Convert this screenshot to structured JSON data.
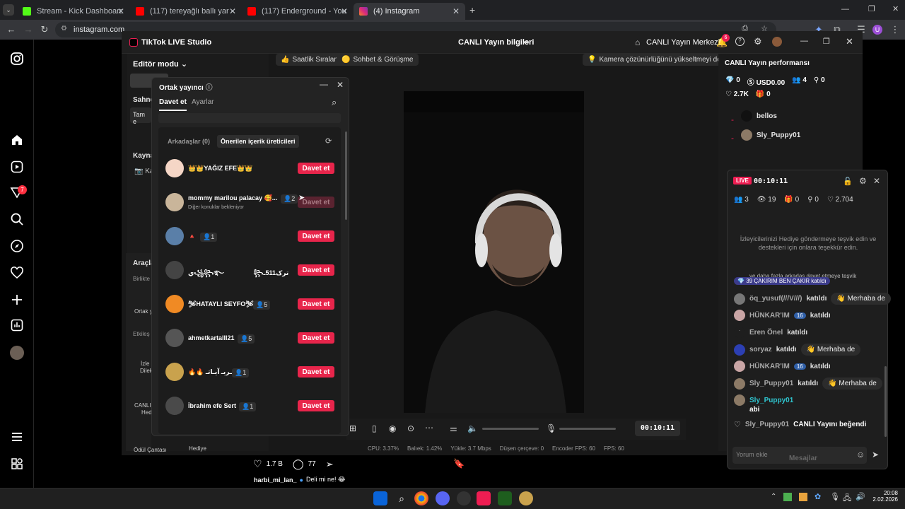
{
  "browser": {
    "tabs": [
      {
        "title": "Stream - Kick Dashboard",
        "color": "#53fc18"
      },
      {
        "title": "(117) tereyağlı ballı yar - YouTube",
        "color": "#ff0000"
      },
      {
        "title": "(117) Enderground - YouTube",
        "color": "#ff0000"
      },
      {
        "title": "(4) Instagram",
        "color": "#e1306c"
      }
    ],
    "url": "instagram.com",
    "profile_initial": "U"
  },
  "instagram": {
    "notif_badge": "7",
    "post_likes": "1.7 B",
    "post_comments": "77",
    "caption_user": "harbi_mi_lan_",
    "caption_text": "Deli mi ne! 😂"
  },
  "studio": {
    "app_title": "TikTok LIVE Studio",
    "center_title": "CANLI Yayın bilgileri",
    "live_center": "CANLI Yayın Merkezi",
    "notif_count": "6",
    "editor_mode": "Editör modu",
    "left_labels": {
      "sahne": "Sahne",
      "tam": "Tam e",
      "kaynak": "Kayna",
      "kamera": "Ka",
      "araclar": "Araçla",
      "birlikte": "Birlikte",
      "ortak": "Ortak y",
      "etkilesim": "Etkileş",
      "izle": "İzle",
      "dile": "Dilek",
      "canli": "CANLI",
      "hed": "Hed",
      "odul": "Ödül Çantası",
      "hediye": "Hediye"
    },
    "top_pills": [
      "Saatlik Sıralama",
      "Sohbet & Görüşme"
    ],
    "camera_hint": "Kamera çözünürlüğünü yükseltmeyi deneyin",
    "perf_title": "CANLI Yayın performansı",
    "perf_stats": {
      "coins": "0",
      "usd": "USD0.00",
      "viewers": "4",
      "followers": "0",
      "likes": "2.7K",
      "gifts": "0"
    },
    "top_viewers": [
      "bellos",
      "Sly_Puppy01"
    ],
    "timer": "00:10:11",
    "stats_bar": {
      "cpu": "CPU:  3.37%",
      "bal": "Balıek:  1.42%",
      "upload": "Yükle:  3.7 Mbps",
      "dropped": "Düşen çerçeve:  0",
      "enc": "Encoder FPS:  60",
      "fps": "FPS:  60"
    }
  },
  "cohost": {
    "title": "Ortak yayıncı",
    "tabs": [
      "Davet et",
      "Ayarlar"
    ],
    "subtabs": [
      "Arkadaşlar (0)",
      "Önerilen içerik üreticileri"
    ],
    "invite_label": "Davet et",
    "waiting": "Diğer konuklar bekleniyor",
    "creators": [
      {
        "name": "👑👑YAĞIZ EFE👑👑",
        "count": "",
        "color": "#f5d6c6"
      },
      {
        "name": "mommy marilou palacay 🥰...",
        "count": "2",
        "color": "#c9b59a"
      },
      {
        "name": "🔺",
        "count": "1",
        "color": "#5a7fa8"
      },
      {
        "name": "ي꧁꧂࿐ㅤㅤㅤㅤㅤ꧂ترک511ـ",
        "count": "",
        "color": "#444"
      },
      {
        "name": "🛩HATAYLI SEYFO🛩",
        "count": "5",
        "color": "#f08a24"
      },
      {
        "name": "ahmetkartalll21",
        "count": "5",
        "color": "#555"
      },
      {
        "name": "🔥🔥 شـربـ آيـاتـ",
        "count": "1",
        "color": "#c9a24d"
      },
      {
        "name": "İbrahim efe Sert",
        "count": "1",
        "color": "#4a4a4a"
      }
    ]
  },
  "live": {
    "badge": "LIVE",
    "timer": "00:10:11",
    "stats": {
      "viewers": "3",
      "views": "19",
      "gifts": "0",
      "follows": "0",
      "likes": "2.704"
    },
    "encourage": "İzleyicilerinizi Hediye göndermeye teşvik edin ve destekleri için onlara teşekkür edin.",
    "scroll_note": "ve daha fazla arkadaş davet etmeye teşvik",
    "chat": [
      {
        "user": "ÇAKIRIM BEN ÇAKIR",
        "level": "39",
        "text": "katıldı",
        "wave": ""
      },
      {
        "user": "öq_yusuf(///V///)",
        "level": "",
        "text": "katıldı",
        "wave": "👋 Merhaba de"
      },
      {
        "user": "HÜNKAR'IM",
        "level": "16",
        "text": "katıldı",
        "wave": ""
      },
      {
        "user": "Eren Önel",
        "level": "",
        "text": "katıldı",
        "wave": ""
      },
      {
        "user": "soryaz",
        "level": "",
        "text": "katıldı",
        "wave": "👋 Merhaba de"
      },
      {
        "user": "HÜNKAR'IM",
        "level": "16",
        "text": "katıldı",
        "wave": ""
      },
      {
        "user": "Sly_Puppy01",
        "level": "",
        "text": "katıldı",
        "wave": "👋 Merhaba de"
      }
    ],
    "last_msg_user": "Sly_Puppy01",
    "last_msg_text": "abi",
    "liked_user": "Sly_Puppy01",
    "liked_text": "CANLI Yayını beğendi",
    "comment_placeholder": "Yorum ekle",
    "messages_label": "Mesajlar"
  },
  "clock": {
    "time": "20:08",
    "date": "2.02.2026"
  }
}
